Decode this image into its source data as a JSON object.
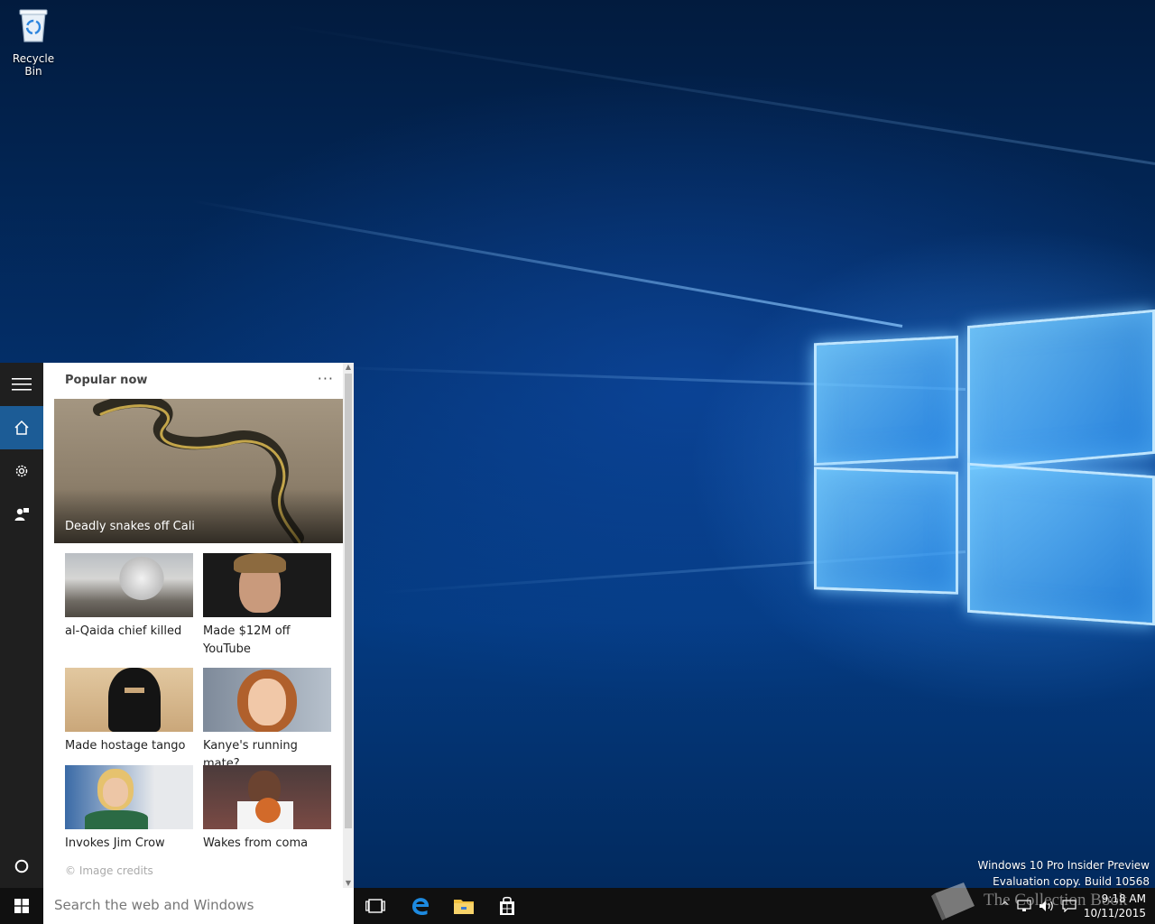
{
  "desktop": {
    "icons": [
      {
        "label": "Recycle Bin",
        "icon": "recycle-bin-icon"
      }
    ],
    "watermark": {
      "line1": "Windows 10 Pro Insider Preview",
      "line2": "Evaluation copy. Build 10568"
    }
  },
  "cortana": {
    "rail": [
      {
        "name": "hamburger-menu",
        "icon": "hamburger-icon"
      },
      {
        "name": "home",
        "icon": "home-icon",
        "active": true
      },
      {
        "name": "settings",
        "icon": "gear-icon"
      },
      {
        "name": "feedback",
        "icon": "feedback-icon"
      }
    ],
    "header": "Popular now",
    "more": "···",
    "hero": {
      "caption": "Deadly snakes off Cali"
    },
    "tiles": [
      {
        "caption": "al-Qaida chief killed"
      },
      {
        "caption": "Made $12M off YouTube"
      },
      {
        "caption": "Made hostage tango"
      },
      {
        "caption": "Kanye's running mate?"
      },
      {
        "caption": "Invokes Jim Crow"
      },
      {
        "caption": "Wakes from coma"
      }
    ],
    "credits": "© Image credits"
  },
  "taskbar": {
    "search": {
      "placeholder": "Search the web and Windows",
      "value": ""
    },
    "apps": [
      "task-view-icon",
      "edge-icon",
      "file-explorer-icon",
      "store-icon"
    ],
    "clock": {
      "time": "9:18 AM",
      "date": "10/11/2015"
    }
  },
  "overlay_watermark": "The Collection Book",
  "colors": {
    "accent": "#1c5c96",
    "rail": "#1f1f1f",
    "taskbar": "#101010"
  }
}
